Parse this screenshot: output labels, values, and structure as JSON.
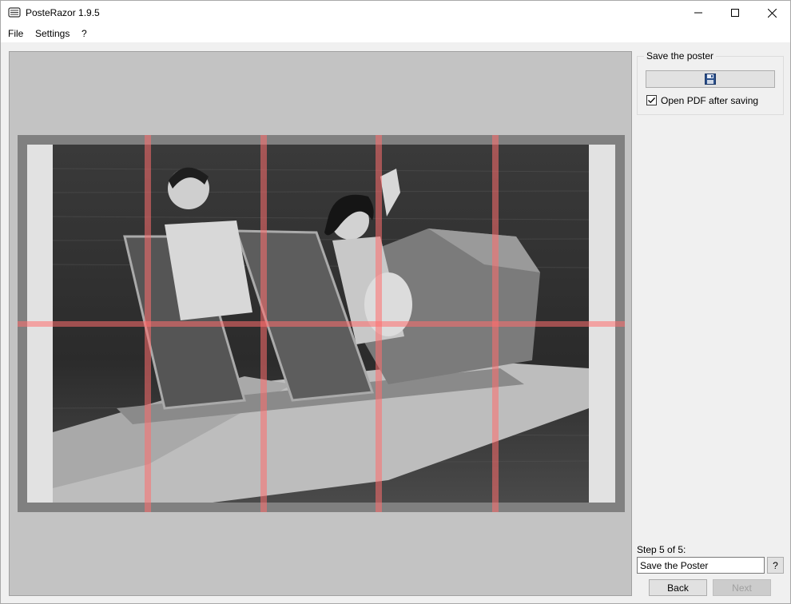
{
  "window": {
    "title": "PosteRazor 1.9.5",
    "icons": {
      "app": "poster-razor-icon",
      "minimize": "minimize-icon",
      "maximize": "maximize-icon",
      "close": "close-icon"
    }
  },
  "menu": {
    "file": "File",
    "settings": "Settings",
    "help": "?"
  },
  "preview": {
    "image_description_icon": "photo-preview",
    "grid": {
      "columns": 5,
      "rows": 2
    }
  },
  "save_group": {
    "title": "Save the poster",
    "save_icon": "floppy-disk-icon",
    "open_pdf_label": "Open PDF after saving",
    "open_pdf_checked": true
  },
  "wizard": {
    "step_label": "Step 5 of 5:",
    "step_name": "Save the Poster",
    "help_label": "?",
    "back_label": "Back",
    "next_label": "Next"
  },
  "colors": {
    "cut_lines": "#ff6e6e",
    "preview_bg": "#c3c3c3",
    "paper_border": "#808080"
  }
}
